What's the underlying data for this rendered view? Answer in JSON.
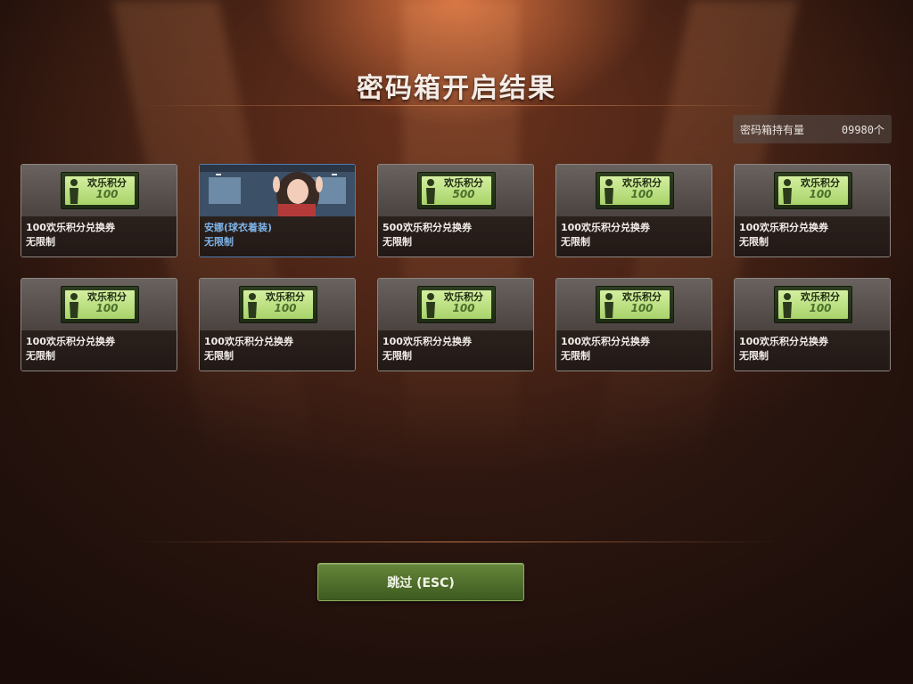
{
  "title": "密码箱开启结果",
  "holding": {
    "label": "密码箱持有量",
    "count": "09980个"
  },
  "rewards": [
    {
      "type": "ticket",
      "ticket_label": "欢乐积分",
      "ticket_value": "100",
      "name": "100欢乐积分兑换券",
      "limit": "无限制"
    },
    {
      "type": "character",
      "name": "安娜(球衣着装)",
      "limit": "无限制"
    },
    {
      "type": "ticket",
      "ticket_label": "欢乐积分",
      "ticket_value": "500",
      "name": "500欢乐积分兑换券",
      "limit": "无限制"
    },
    {
      "type": "ticket",
      "ticket_label": "欢乐积分",
      "ticket_value": "100",
      "name": "100欢乐积分兑换券",
      "limit": "无限制"
    },
    {
      "type": "ticket",
      "ticket_label": "欢乐积分",
      "ticket_value": "100",
      "name": "100欢乐积分兑换券",
      "limit": "无限制"
    },
    {
      "type": "ticket",
      "ticket_label": "欢乐积分",
      "ticket_value": "100",
      "name": "100欢乐积分兑换券",
      "limit": "无限制"
    },
    {
      "type": "ticket",
      "ticket_label": "欢乐积分",
      "ticket_value": "100",
      "name": "100欢乐积分兑换券",
      "limit": "无限制"
    },
    {
      "type": "ticket",
      "ticket_label": "欢乐积分",
      "ticket_value": "100",
      "name": "100欢乐积分兑换券",
      "limit": "无限制"
    },
    {
      "type": "ticket",
      "ticket_label": "欢乐积分",
      "ticket_value": "100",
      "name": "100欢乐积分兑换券",
      "limit": "无限制"
    },
    {
      "type": "ticket",
      "ticket_label": "欢乐积分",
      "ticket_value": "100",
      "name": "100欢乐积分兑换券",
      "limit": "无限制"
    }
  ],
  "skip_button": "跳过 (ESC)",
  "colors": {
    "accent_green": "#65863a",
    "highlight_blue": "#7db4e8",
    "ticket_green": "#a8d36a"
  }
}
